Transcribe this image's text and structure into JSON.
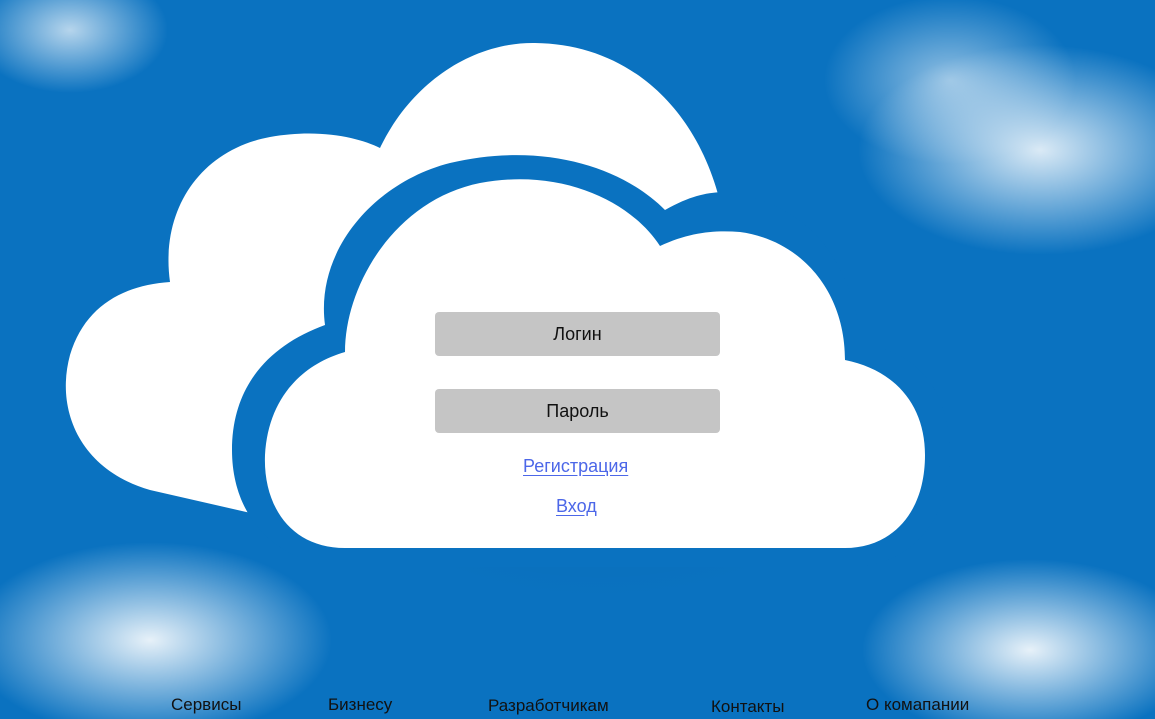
{
  "colors": {
    "sky": "#0a72c0",
    "cloud": "#ffffff",
    "field_bg": "#c5c5c5",
    "link": "#4c67e8",
    "footer_text": "#111111"
  },
  "form": {
    "login_label": "Логин",
    "password_label": "Пароль",
    "register_link": "Регистрация",
    "signin_link": "Вход"
  },
  "footer": {
    "items": [
      {
        "label": "Сервисы"
      },
      {
        "label": "Бизнесу"
      },
      {
        "label": "Разработчикам"
      },
      {
        "label": "Контакты"
      },
      {
        "label": "О комапании"
      }
    ]
  }
}
